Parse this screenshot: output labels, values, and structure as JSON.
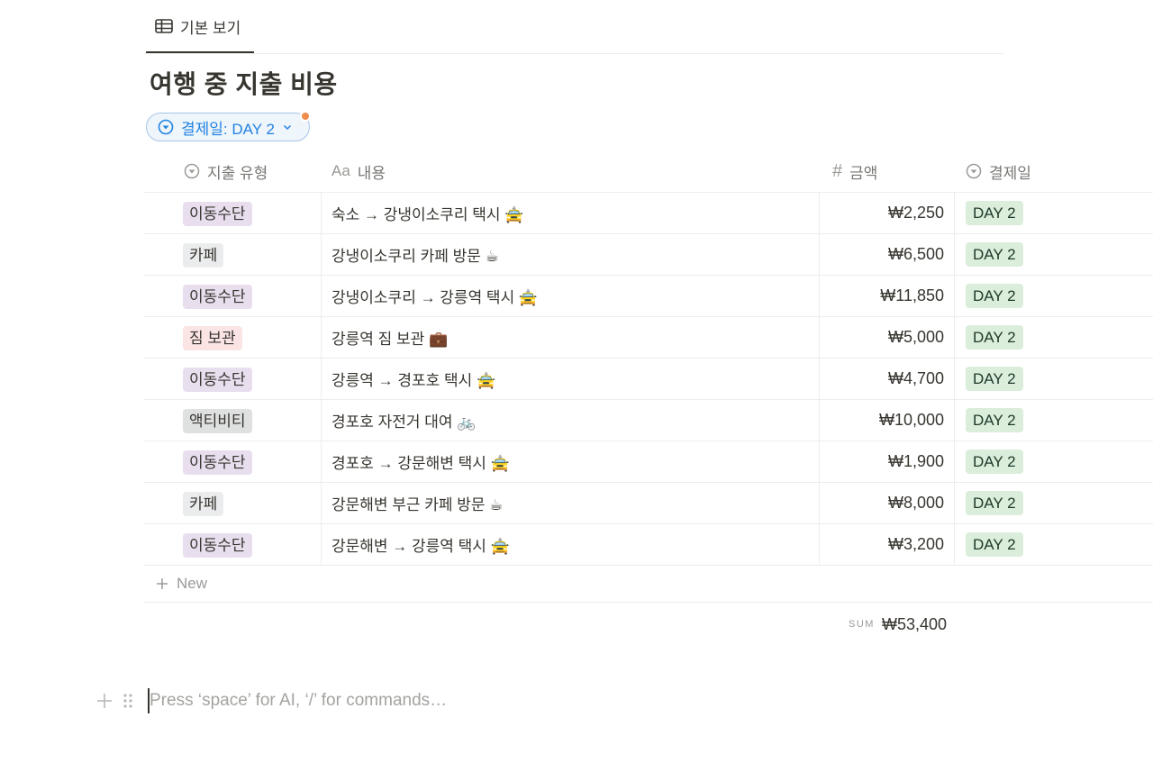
{
  "view_tab": {
    "label": "기본 보기"
  },
  "page_title": "여행 중 지출 비용",
  "filter": {
    "label": "결제일: DAY 2"
  },
  "columns": [
    {
      "label": "지출 유형"
    },
    {
      "label": "내용",
      "prefix": "Aa"
    },
    {
      "label": "금액",
      "prefix": "#"
    },
    {
      "label": "결제일"
    }
  ],
  "rows": [
    {
      "type": "이동수단",
      "type_color": "purple",
      "desc": "숙소 → 강냉이소쿠리 택시 🚖",
      "amount": "₩2,250",
      "date": "DAY 2"
    },
    {
      "type": "카페",
      "type_color": "gray",
      "desc": "강냉이소쿠리 카페 방문 ☕",
      "amount": "₩6,500",
      "date": "DAY 2"
    },
    {
      "type": "이동수단",
      "type_color": "purple",
      "desc": "강냉이소쿠리 → 강릉역 택시 🚖",
      "amount": "₩11,850",
      "date": "DAY 2"
    },
    {
      "type": "짐 보관",
      "type_color": "red",
      "desc": "강릉역 짐 보관 💼",
      "amount": "₩5,000",
      "date": "DAY 2"
    },
    {
      "type": "이동수단",
      "type_color": "purple",
      "desc": "강릉역 → 경포호 택시 🚖",
      "amount": "₩4,700",
      "date": "DAY 2"
    },
    {
      "type": "액티비티",
      "type_color": "darkgray",
      "desc": "경포호 자전거 대여 🚲",
      "amount": "₩10,000",
      "date": "DAY 2"
    },
    {
      "type": "이동수단",
      "type_color": "purple",
      "desc": "경포호 → 강문해변 택시 🚖",
      "amount": "₩1,900",
      "date": "DAY 2"
    },
    {
      "type": "카페",
      "type_color": "gray",
      "desc": "강문해변 부근 카페 방문 ☕",
      "amount": "₩8,000",
      "date": "DAY 2"
    },
    {
      "type": "이동수단",
      "type_color": "purple",
      "desc": "강문해변 → 강릉역 택시 🚖",
      "amount": "₩3,200",
      "date": "DAY 2"
    }
  ],
  "new_row_label": "New",
  "sum": {
    "label": "SUM",
    "value": "₩53,400"
  },
  "block_hint": "Press ‘space’ for AI, ‘/’ for commands…",
  "colors": {
    "accent": "#2383e2",
    "tag_purple": "#e8deee",
    "tag_gray": "#ebeced",
    "tag_red": "#fbe4e4",
    "tag_darkgray": "#dfe0e0",
    "date_green": "#dbeddb"
  },
  "icons": {
    "view_tab": "table-icon",
    "filter": "select-circle-icon",
    "type_col": "select-circle-icon",
    "amount_col": "hash-icon",
    "date_col": "select-circle-icon",
    "new_row": "plus-icon",
    "block_add": "plus-icon",
    "block_drag": "drag-handle-icon"
  }
}
